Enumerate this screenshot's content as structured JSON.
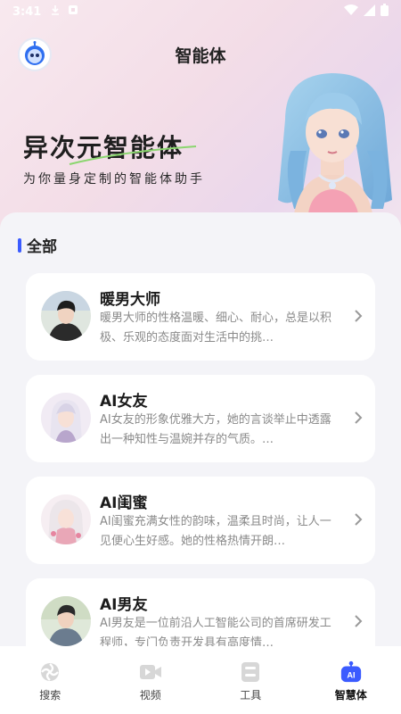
{
  "status_bar": {
    "time": "3:41"
  },
  "header": {
    "title": "智能体"
  },
  "hero": {
    "heading": "异次元智能体",
    "subtitle": "为你量身定制的智能体助手"
  },
  "section": {
    "title": "全部"
  },
  "agents": [
    {
      "name": "暖男大师",
      "description": "暖男大师的性格温暖、细心、耐心，总是以积极、乐观的态度面对生活中的挑…"
    },
    {
      "name": "AI女友",
      "description": "AI女友的形象优雅大方，她的言谈举止中透露出一种知性与温婉并存的气质。…"
    },
    {
      "name": "AI闺蜜",
      "description": "AI闺蜜充满女性的韵味，温柔且时尚，让人一见便心生好感。她的性格热情开朗…"
    },
    {
      "name": "AI男友",
      "description": "AI男友是一位前沿人工智能公司的首席研发工程师，专门负责开发具有高度情…"
    }
  ],
  "bottom_nav": {
    "items": [
      {
        "label": "搜索",
        "icon": "search-icon",
        "active": false
      },
      {
        "label": "视频",
        "icon": "video-icon",
        "active": false
      },
      {
        "label": "工具",
        "icon": "tools-icon",
        "active": false
      },
      {
        "label": "智慧体",
        "icon": "ai-robot-icon",
        "active": true
      }
    ]
  },
  "colors": {
    "accent": "#3b5bff",
    "hero_gradient_start": "#f8e9ef",
    "hero_gradient_end": "#ead7ec",
    "swoosh_green": "#8bd66f"
  }
}
